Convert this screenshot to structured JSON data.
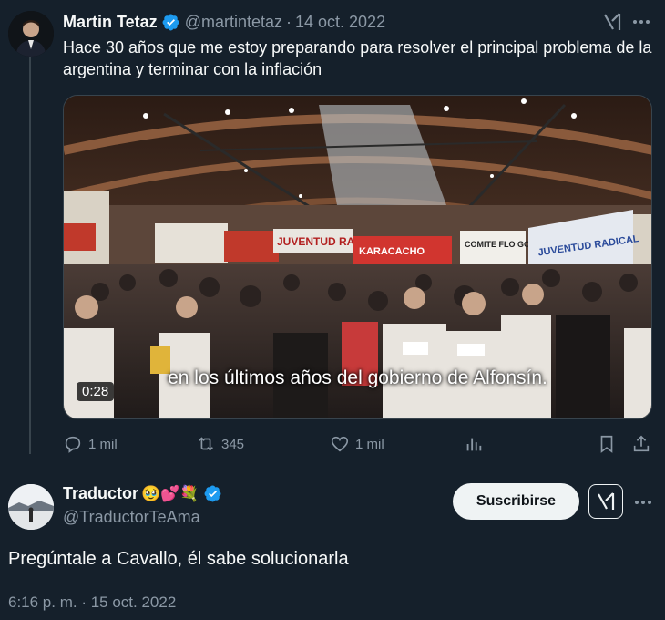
{
  "tweet": {
    "author_name": "Martin Tetaz",
    "handle": "@martintetaz",
    "separator": "·",
    "date": "14 oct. 2022",
    "text": "Hace 30 años que me estoy preparando para resolver el principal problema de la argentina y terminar con la inflación",
    "media": {
      "subtitle": "en los últimos años del gobierno de Alfonsín.",
      "duration": "0:28",
      "banners": [
        "JUVENTUD RADICAL",
        "KARACACHO",
        "COMITE FLO GOMEZ",
        "JUVENTUD RADICAL"
      ]
    },
    "actions": {
      "replies": "1 mil",
      "reposts": "345",
      "likes": "1 mil"
    }
  },
  "reply": {
    "author_name": "Traductor",
    "emojis": "🥹💕💐",
    "handle": "@TraductorTeAma",
    "subscribe_label": "Suscribirse",
    "text": "Pregúntale a Cavallo, él sabe solucionarla",
    "timestamp": "6:16 p. m. · 15 oct. 2022"
  },
  "colors": {
    "background": "#15202b",
    "verified_blue": "#1d9bf0",
    "muted": "#8b98a5",
    "text": "#f7f9f9",
    "border": "#38444d"
  },
  "icons": [
    "verified-badge-icon",
    "grok-icon",
    "more-icon",
    "reply-icon",
    "repost-icon",
    "like-icon",
    "views-icon",
    "bookmark-icon",
    "share-icon"
  ]
}
